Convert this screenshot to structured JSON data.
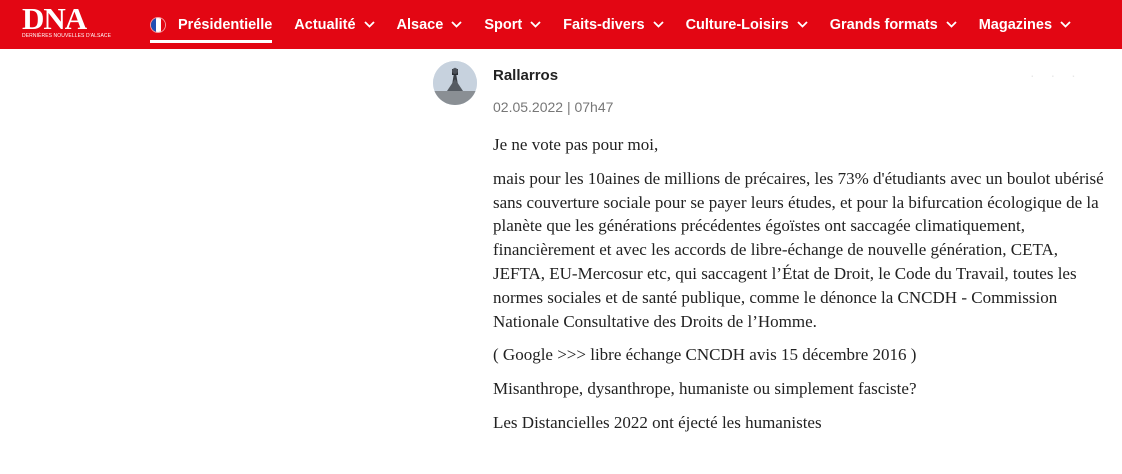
{
  "header": {
    "logo_text": "DNA",
    "logo_subtitle": "DERNIÈRES NOUVELLES D'ALSACE",
    "nav": [
      {
        "label": "Présidentielle",
        "active": true,
        "has_chevron": false,
        "flag": "france-flag-icon"
      },
      {
        "label": "Actualité",
        "active": false,
        "has_chevron": true
      },
      {
        "label": "Alsace",
        "active": false,
        "has_chevron": true
      },
      {
        "label": "Sport",
        "active": false,
        "has_chevron": true
      },
      {
        "label": "Faits-divers",
        "active": false,
        "has_chevron": true
      },
      {
        "label": "Culture-Loisirs",
        "active": false,
        "has_chevron": true
      },
      {
        "label": "Grands formats",
        "active": false,
        "has_chevron": true
      },
      {
        "label": "Magazines",
        "active": false,
        "has_chevron": true
      }
    ],
    "colors": {
      "brand": "#e30613",
      "text": "#ffffff"
    }
  },
  "comment": {
    "author": "Rallarros",
    "date": "02.05.2022 | 07h47",
    "paragraphs": [
      "Je ne vote pas pour moi,",
      "mais pour les 10aines de millions de précaires, les 73% d'étudiants avec un boulot ubérisé sans couverture sociale pour se payer leurs études, et pour la bifurcation écologique de la planète que les générations précédentes égoïstes ont saccagée climatiquement, financièrement et avec les accords de libre-échange de nouvelle génération, CETA, JEFTA, EU-Mercosur etc, qui saccagent l’État de Droit, le Code du Travail, toutes les normes sociales et de santé publique, comme le dénonce la CNCDH - Commission Nationale Consultative des Droits de l’Homme.",
      "( Google >>> libre échange CNCDH avis 15 décembre 2016 )",
      "Misanthrope, dysanthrope, humaniste ou simplement fasciste?",
      "Les Distancielles 2022 ont éjecté les humanistes"
    ]
  }
}
